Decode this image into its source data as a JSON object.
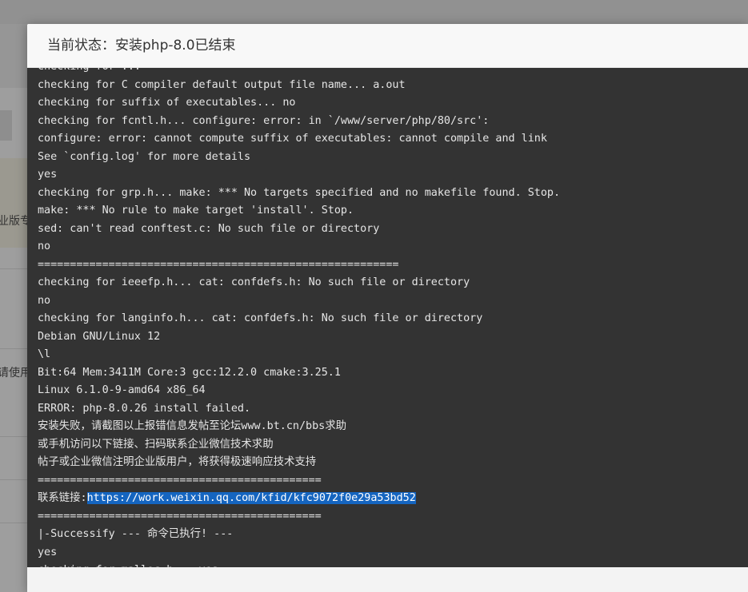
{
  "background": {
    "fragment_1": "业版专",
    "fragment_2": "请使用"
  },
  "dialog": {
    "title": "当前状态：安装php-8.0已结束"
  },
  "terminal": {
    "partial_top_line": "checking for ... ",
    "lines": [
      "checking for C compiler default output file name... a.out",
      "checking for suffix of executables... no",
      "checking for fcntl.h... configure: error: in `/www/server/php/80/src':",
      "configure: error: cannot compute suffix of executables: cannot compile and link",
      "See `config.log' for more details",
      "yes",
      "checking for grp.h... make: *** No targets specified and no makefile found. Stop.",
      "make: *** No rule to make target 'install'. Stop.",
      "sed: can't read conftest.c: No such file or directory",
      "no",
      "========================================================",
      "checking for ieeefp.h... cat: confdefs.h: No such file or directory",
      "no",
      "checking for langinfo.h... cat: confdefs.h: No such file or directory",
      "Debian GNU/Linux 12",
      "\\l",
      "Bit:64 Mem:3411M Core:3 gcc:12.2.0 cmake:3.25.1",
      "Linux 6.1.0-9-amd64 x86_64",
      "ERROR: php-8.0.26 install failed.",
      "安装失败，请截图以上报错信息发帖至论坛www.bt.cn/bbs求助",
      "或手机访问以下链接、扫码联系企业微信技术求助",
      "帖子或企业微信注明企业版用户，将获得极速响应技术支持",
      "============================================"
    ],
    "contact_prefix": "联系链接:",
    "contact_link": "https://work.weixin.qq.com/kfid/kfc9072f0e29a53bd52",
    "lines_after": [
      "============================================",
      "|-Successify --- 命令已执行! ---",
      "yes",
      "checking for malloc.h... yes"
    ]
  }
}
